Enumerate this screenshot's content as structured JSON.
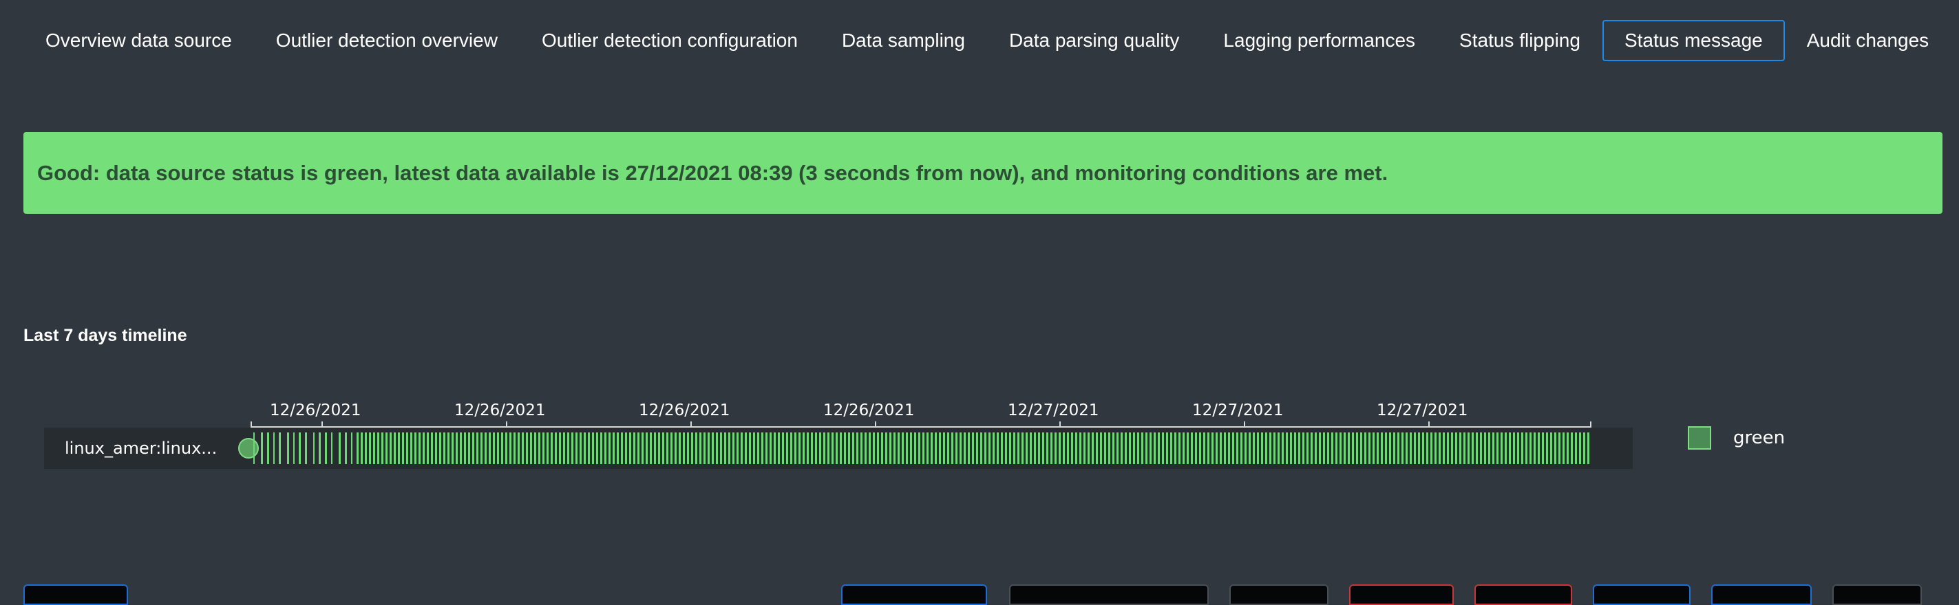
{
  "tabs": [
    {
      "label": "Overview data source"
    },
    {
      "label": "Outlier detection overview"
    },
    {
      "label": "Outlier detection configuration"
    },
    {
      "label": "Data sampling"
    },
    {
      "label": "Data parsing quality"
    },
    {
      "label": "Lagging performances"
    },
    {
      "label": "Status flipping"
    },
    {
      "label": "Status message",
      "active": true
    },
    {
      "label": "Audit changes"
    }
  ],
  "banner": {
    "text": "Good: data source status is green, latest data available is 27/12/2021 08:39 (3 seconds from now), and monitoring conditions are met.",
    "color": "#75df79"
  },
  "timeline": {
    "title": "Last 7 days timeline",
    "axis_ticks": [
      "12/26/2021",
      "12/26/2021",
      "12/26/2021",
      "12/26/2021",
      "12/27/2021",
      "12/27/2021",
      "12/27/2021"
    ],
    "row_label": "linux_amer:linux...",
    "legend": {
      "label": "green",
      "color": "#6ed776"
    }
  },
  "bottom_buttons": [
    {
      "border": "#1d6fd6"
    },
    {
      "border": "#1d6fd6"
    },
    {
      "border": "#4a4f55"
    },
    {
      "border": "#4a4f55"
    },
    {
      "border": "#c9363a"
    },
    {
      "border": "#c9363a"
    },
    {
      "border": "#1d6fd6"
    },
    {
      "border": "#1d6fd6"
    },
    {
      "border": "#4a4f55"
    }
  ]
}
